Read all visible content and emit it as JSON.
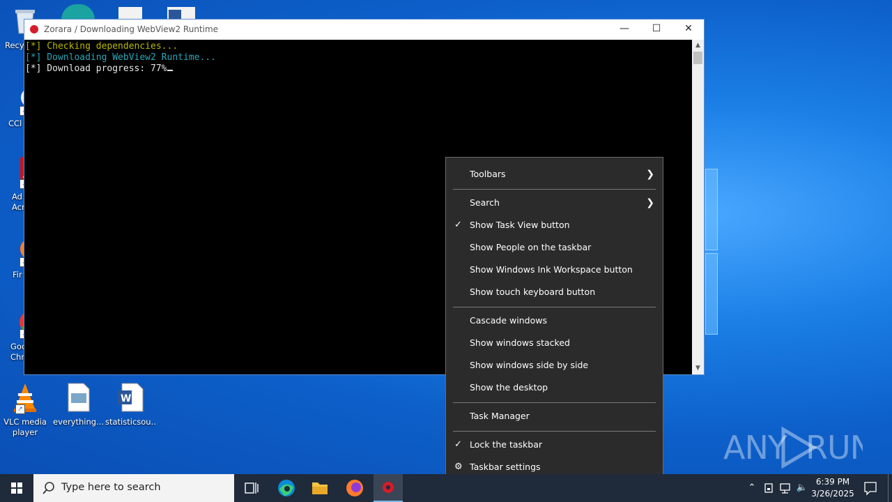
{
  "console": {
    "title": "Zorara / Downloading WebView2 Runtime",
    "lines": [
      {
        "text": "[*] Checking dependencies...",
        "color": "#b8b800"
      },
      {
        "text": "[*] Downloading WebView2 Runtime...",
        "color": "#2aa7b8"
      },
      {
        "text": "[*] Download progress: 77%",
        "color": "#e6e6e6"
      }
    ],
    "minimize_glyph": "—",
    "maximize_glyph": "☐",
    "close_glyph": "✕"
  },
  "desktop_icons": [
    {
      "label": "Recy",
      "icon": "recycle-bin-icon"
    },
    {
      "label": "CCl",
      "icon": "ccleaner-icon"
    },
    {
      "label": "Ad\nAcr",
      "icon": "acrobat-icon"
    },
    {
      "label": "Fir",
      "icon": "firefox-icon"
    },
    {
      "label": "Goo\nChr",
      "icon": "chrome-icon"
    },
    {
      "label": "VLC media\nplayer",
      "icon": "vlc-icon"
    },
    {
      "label": "everything...",
      "icon": "image-file-icon"
    },
    {
      "label": "statisticsou...",
      "icon": "word-doc-icon"
    }
  ],
  "context_menu": {
    "items": [
      {
        "label": "Toolbars",
        "submenu": true
      },
      {
        "label": "Search",
        "submenu": true
      },
      {
        "label": "Show Task View button",
        "checked": true
      },
      {
        "label": "Show People on the taskbar"
      },
      {
        "label": "Show Windows Ink Workspace button"
      },
      {
        "label": "Show touch keyboard button"
      },
      {
        "label": "Cascade windows"
      },
      {
        "label": "Show windows stacked"
      },
      {
        "label": "Show windows side by side"
      },
      {
        "label": "Show the desktop"
      },
      {
        "label": "Task Manager"
      },
      {
        "label": "Lock the taskbar",
        "checked": true
      },
      {
        "label": "Taskbar settings",
        "icon": "gear-icon"
      }
    ]
  },
  "taskbar": {
    "search_placeholder": "Type here to search",
    "time": "6:39 PM",
    "date": "3/26/2025",
    "pinned": [
      "task-view-icon",
      "edge-icon",
      "file-explorer-icon",
      "firefox-icon",
      "zorara-app-icon"
    ]
  },
  "watermark": "ANY RUN",
  "colors": {
    "menu_bg": "#2b2b2b",
    "taskbar_bg": "#1f2a3a",
    "desktop_blue": "#0d5fc9"
  }
}
